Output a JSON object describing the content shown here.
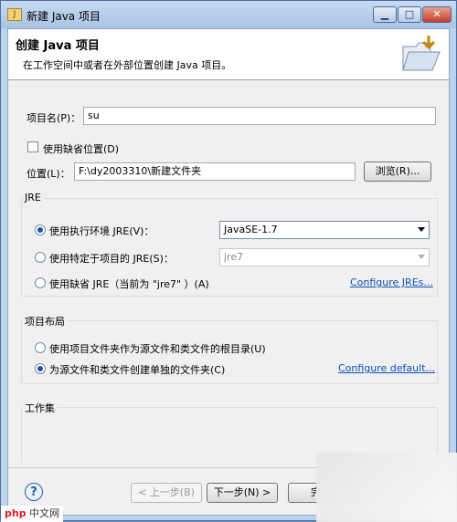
{
  "window": {
    "title": "新建 Java 项目",
    "icon": "java-project-icon",
    "controls": {
      "minimize": "▁",
      "maximize": "□",
      "close": "✕"
    }
  },
  "banner": {
    "title": "创建 Java 项目",
    "description": "在工作空间中或者在外部位置创建 Java 项目。",
    "icon": "folder-icon"
  },
  "project": {
    "name_label": "项目名(P)：",
    "name_value": "su",
    "use_default_location_label": "使用缺省位置(D)",
    "use_default_location_checked": false,
    "location_label": "位置(L)：",
    "location_value": "F:\\dy2003310\\新建文件夹",
    "browse_label": "浏览(R)..."
  },
  "jre": {
    "group_title": "JRE",
    "options": [
      {
        "label": "使用执行环境 JRE(V)：",
        "checked": true,
        "combo_value": "JavaSE-1.7",
        "combo_enabled": true
      },
      {
        "label": "使用特定于项目的 JRE(S)：",
        "checked": false,
        "combo_value": "jre7",
        "combo_enabled": false
      },
      {
        "label": "使用缺省 JRE（当前为 \"jre7\" ）(A)",
        "checked": false,
        "link": "Configure JREs..."
      }
    ]
  },
  "layout": {
    "group_title": "项目布局",
    "options": [
      {
        "label": "使用项目文件夹作为源文件和类文件的根目录(U)",
        "checked": false
      },
      {
        "label": "为源文件和类文件创建单独的文件夹(C)",
        "checked": true,
        "link": "Configure default..."
      }
    ]
  },
  "workingset": {
    "group_title": "工作集"
  },
  "footer": {
    "help": "?",
    "back_label": "< 上一步(B)",
    "next_label": "下一步(N) >",
    "finish_label": "完"
  },
  "watermark": {
    "logo": "php",
    "text": "中文网"
  },
  "colors": {
    "accent": "#1d52a8",
    "link": "#0b4fb3"
  }
}
